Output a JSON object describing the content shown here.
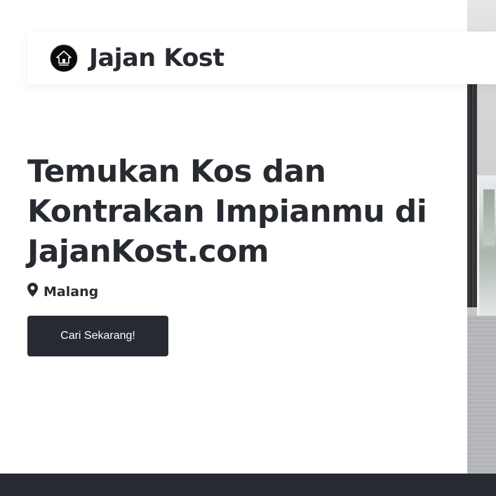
{
  "navbar": {
    "brand_name": "Jajan Kost",
    "logo_icon": "house-logo-icon"
  },
  "hero": {
    "title": "Temukan Kos dan Kontrakan Impianmu di JajanKost.com",
    "location_icon": "map-pin-icon",
    "location": "Malang",
    "cta_label": "Cari Sekarang!",
    "photo": "room-interior-photo"
  },
  "colors": {
    "primary_dark": "#272a30",
    "background": "#ffffff",
    "button_text": "#ffffff"
  }
}
